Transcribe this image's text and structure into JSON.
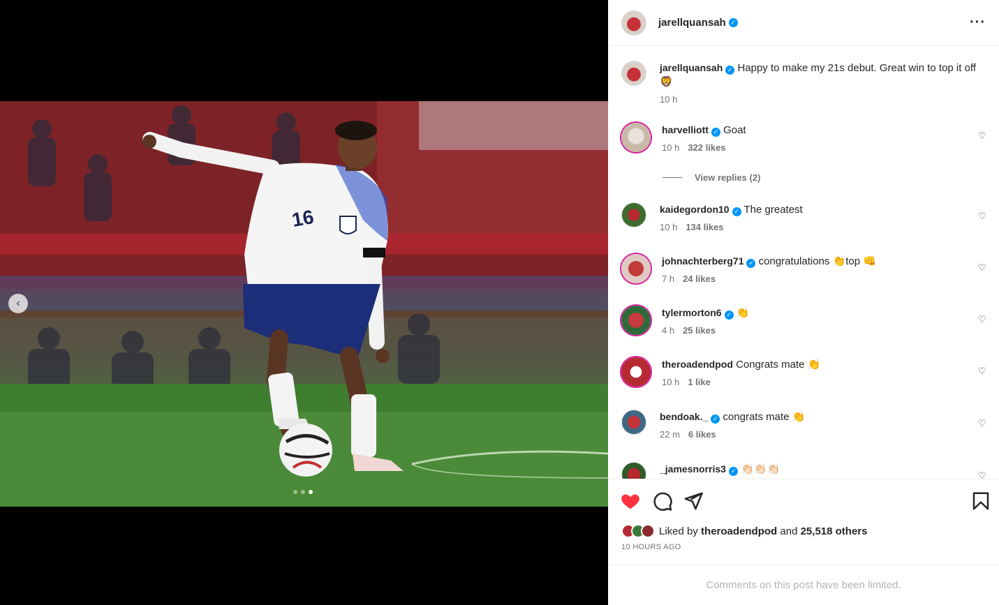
{
  "post": {
    "author": "jarellquansah",
    "caption_author": "jarellquansah",
    "caption": "Happy to make my 21s debut. Great win to top it off 🦁",
    "caption_time": "10 h",
    "carousel": {
      "current": 3,
      "total": 3
    },
    "liked_by_user": "theroadendpod",
    "liked_by_prefix": "Liked by",
    "liked_by_and": "and",
    "liked_by_others": "25,518 others",
    "timestamp": "10 HOURS AGO",
    "limited_notice": "Comments on this post have been limited."
  },
  "comments": [
    {
      "user": "harvelliott",
      "verified": true,
      "text": "Goat",
      "time": "10 h",
      "likes": "322 likes",
      "replies": "View replies (2)"
    },
    {
      "user": "kaidegordon10",
      "verified": true,
      "text": "The greatest",
      "time": "10 h",
      "likes": "134 likes"
    },
    {
      "user": "johnachterberg71",
      "verified": true,
      "text": "congratulations 👏top 👊",
      "time": "7 h",
      "likes": "24 likes"
    },
    {
      "user": "tylermorton6",
      "verified": true,
      "text": "👏",
      "time": "4 h",
      "likes": "25 likes"
    },
    {
      "user": "theroadendpod",
      "verified": false,
      "text": "Congrats mate 👏",
      "time": "10 h",
      "likes": "1 like"
    },
    {
      "user": "bendoak._",
      "verified": true,
      "text": "congrats mate 👏",
      "time": "22 m",
      "likes": "6 likes"
    },
    {
      "user": "_jamesnorris3",
      "verified": true,
      "text": "👏🏻👏🏻👏🏻",
      "time": "",
      "likes": ""
    }
  ],
  "icons": {
    "more": "more-options-icon",
    "like": "heart-filled-icon",
    "comment": "comment-icon",
    "share": "share-icon",
    "save": "bookmark-icon",
    "verified": "verified-badge-icon"
  },
  "colors": {
    "like_red": "#ff3040",
    "verified_blue": "#0095f6",
    "text": "#262626",
    "secondary": "#737373"
  }
}
